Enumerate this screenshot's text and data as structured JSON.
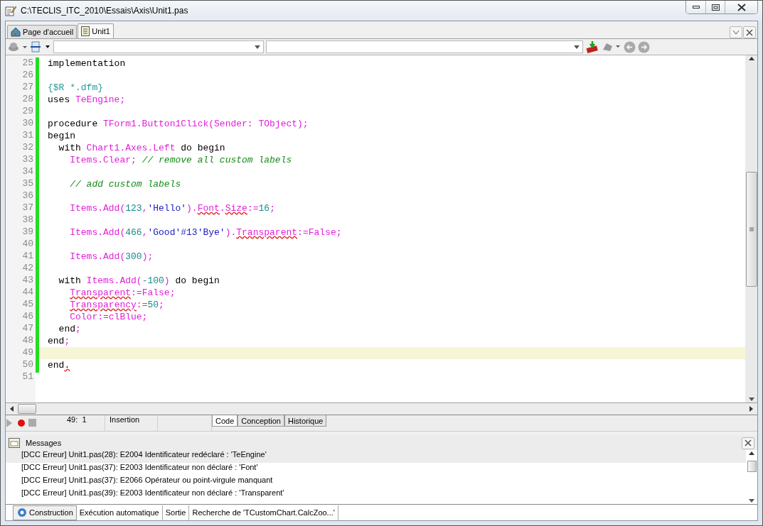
{
  "window": {
    "title": "C:\\TECLIS_ITC_2010\\Essais\\Axis\\Unit1.pas"
  },
  "doc_tabs": [
    {
      "label": "Page d'accueil",
      "kind": "home",
      "selected": false
    },
    {
      "label": "Unit1",
      "kind": "unit",
      "selected": true
    }
  ],
  "editor": {
    "lines": [
      {
        "number": "25",
        "current": false,
        "tokens": [
          {
            "kind": "kw",
            "text": "implementation"
          }
        ]
      },
      {
        "number": "26",
        "current": false
      },
      {
        "number": "27",
        "current": false,
        "tokens": [
          {
            "kind": "dir",
            "text": "{$R *.dfm}"
          }
        ]
      },
      {
        "number": "28",
        "current": false,
        "tokens": [
          {
            "kind": "kw",
            "text": "uses "
          },
          {
            "kind": "id",
            "text": "TeEngine;"
          }
        ]
      },
      {
        "number": "29",
        "current": false
      },
      {
        "number": "30",
        "current": false,
        "tokens": [
          {
            "kind": "kw",
            "text": "procedure "
          },
          {
            "kind": "id",
            "text": "TForm1.Button1Click(Sender: TObject);"
          }
        ]
      },
      {
        "number": "31",
        "current": false,
        "tokens": [
          {
            "kind": "kw",
            "text": "begin"
          }
        ]
      },
      {
        "number": "32",
        "current": false,
        "tokens": [
          {
            "kind": "kw",
            "text": "  with "
          },
          {
            "kind": "id",
            "text": "Chart1.Axes.Left "
          },
          {
            "kind": "kw",
            "text": "do begin"
          }
        ]
      },
      {
        "number": "33",
        "current": false,
        "tokens": [
          {
            "kind": "id",
            "text": "    Items.Clear; "
          },
          {
            "kind": "cmt",
            "text": "// remove all custom labels"
          }
        ]
      },
      {
        "number": "34",
        "current": false
      },
      {
        "number": "35",
        "current": false,
        "tokens": [
          {
            "kind": "cmt",
            "text": "    // add custom labels"
          }
        ]
      },
      {
        "number": "36",
        "current": false
      },
      {
        "number": "37",
        "current": false,
        "tokens": [
          {
            "kind": "id",
            "text": "    Items.Add("
          },
          {
            "kind": "num",
            "text": "123"
          },
          {
            "kind": "id",
            "text": ","
          },
          {
            "kind": "str",
            "text": "'Hello'"
          },
          {
            "kind": "id",
            "text": ")."
          },
          {
            "kind": "err",
            "text": "Font"
          },
          {
            "kind": "id",
            "text": "."
          },
          {
            "kind": "err",
            "text": "Size"
          },
          {
            "kind": "id",
            "text": ":="
          },
          {
            "kind": "num",
            "text": "16"
          },
          {
            "kind": "id",
            "text": ";"
          }
        ]
      },
      {
        "number": "38",
        "current": false
      },
      {
        "number": "39",
        "current": false,
        "tokens": [
          {
            "kind": "id",
            "text": "    Items.Add("
          },
          {
            "kind": "num",
            "text": "466"
          },
          {
            "kind": "id",
            "text": ","
          },
          {
            "kind": "str",
            "text": "'Good'#13'Bye'"
          },
          {
            "kind": "id",
            "text": ")."
          },
          {
            "kind": "err",
            "text": "Transparent"
          },
          {
            "kind": "id",
            "text": ":=False;"
          }
        ]
      },
      {
        "number": "40",
        "current": false
      },
      {
        "number": "41",
        "current": false,
        "tokens": [
          {
            "kind": "id",
            "text": "    Items.Add("
          },
          {
            "kind": "num",
            "text": "300"
          },
          {
            "kind": "id",
            "text": ");"
          }
        ]
      },
      {
        "number": "42",
        "current": false
      },
      {
        "number": "43",
        "current": false,
        "tokens": [
          {
            "kind": "kw",
            "text": "  with "
          },
          {
            "kind": "id",
            "text": "Items.Add("
          },
          {
            "kind": "num",
            "text": "-100"
          },
          {
            "kind": "id",
            "text": ") "
          },
          {
            "kind": "kw",
            "text": "do begin"
          }
        ]
      },
      {
        "number": "44",
        "current": false,
        "tokens": [
          {
            "kind": "err",
            "text": "    Transparent"
          },
          {
            "kind": "id",
            "text": ":=False;"
          }
        ]
      },
      {
        "number": "45",
        "current": false,
        "tokens": [
          {
            "kind": "err",
            "text": "    Transparency"
          },
          {
            "kind": "id",
            "text": ":="
          },
          {
            "kind": "num",
            "text": "50"
          },
          {
            "kind": "id",
            "text": ";"
          }
        ]
      },
      {
        "number": "46",
        "current": false,
        "tokens": [
          {
            "kind": "id",
            "text": "    Color:=clBlue;"
          }
        ]
      },
      {
        "number": "47",
        "current": false,
        "tokens": [
          {
            "kind": "kw",
            "text": "  end"
          },
          {
            "kind": "id",
            "text": ";"
          }
        ]
      },
      {
        "number": "48",
        "current": false,
        "tokens": [
          {
            "kind": "kw",
            "text": "end"
          },
          {
            "kind": "id",
            "text": ";"
          }
        ]
      },
      {
        "number": "49",
        "current": true
      },
      {
        "number": "50",
        "current": false,
        "tokens": [
          {
            "kind": "kw",
            "text": "end"
          },
          {
            "kind": "kwerr",
            "text": "."
          }
        ]
      },
      {
        "number": "51",
        "current": false
      }
    ]
  },
  "status_bar": {
    "position": "49:  1",
    "mode": "Insertion"
  },
  "view_tabs": [
    {
      "label": "Code",
      "selected": true
    },
    {
      "label": "Conception",
      "selected": false
    },
    {
      "label": "Historique",
      "selected": false
    }
  ],
  "messages": {
    "title": "Messages",
    "rows": [
      {
        "text": "[DCC Erreur] Unit1.pas(28): E2004 Identificateur redéclaré : 'TeEngine'",
        "selected": true
      },
      {
        "text": "[DCC Erreur] Unit1.pas(37): E2003 Identificateur non déclaré : 'Font'",
        "selected": false
      },
      {
        "text": "[DCC Erreur] Unit1.pas(37): E2066 Opérateur ou point-virgule manquant",
        "selected": false
      },
      {
        "text": "[DCC Erreur] Unit1.pas(39): E2003 Identificateur non déclaré : 'Transparent'",
        "selected": false
      }
    ]
  },
  "bottom_tabs": [
    {
      "label": "Construction",
      "selected": true
    },
    {
      "label": "Exécution automatique",
      "selected": false
    },
    {
      "label": "Sortie",
      "selected": false
    },
    {
      "label": "Recherche de 'TCustomChart.CalcZoo...'",
      "selected": false
    }
  ]
}
